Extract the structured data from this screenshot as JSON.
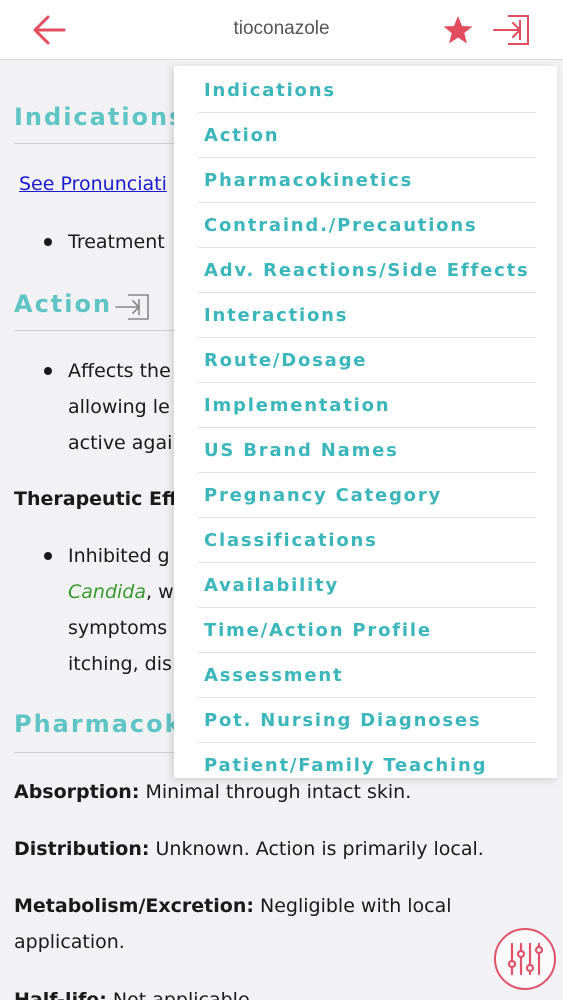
{
  "header": {
    "title": "tioconazole"
  },
  "colors": {
    "accent_red": "#e24c5e",
    "heading_teal": "#5fc4c4",
    "menu_teal": "#3bb6bb",
    "link_blue": "#1a1acc",
    "italic_green": "#3a9a2e"
  },
  "icons": {
    "back": "arrow-left-icon",
    "favorite": "star-icon",
    "exit": "exit-arrow-icon",
    "section_jump": "exit-arrow-icon",
    "filter": "sliders-icon"
  },
  "content": {
    "indications_heading": "Indications",
    "pronunciation_link": "See Pronunciati",
    "indication_bullet": "Treatment",
    "action_heading": "Action",
    "action_line1": "Affects the",
    "action_line2": "allowing le",
    "action_line3": "active agai",
    "therapeutic_heading": "Therapeutic Eff",
    "therapeutic_line1": "Inhibited g",
    "therapeutic_line2_italic": "Candida",
    "therapeutic_line2_rest": ", w",
    "therapeutic_line3": "symptoms",
    "therapeutic_line4": "itching, dis",
    "pharmacokinetics_heading": "Pharmacok",
    "absorption_label": "Absorption:",
    "absorption_value": " Minimal through intact skin.",
    "distribution_label": "Distribution:",
    "distribution_value": " Unknown. Action is primarily local.",
    "metabolism_label": "Metabolism/Excretion:",
    "metabolism_value": " Negligible with local",
    "metabolism_value2": "application.",
    "halflife_label": "Half-life:",
    "halflife_value": " Not applicable"
  },
  "menu": {
    "items": [
      "Indications",
      "Action",
      "Pharmacokinetics",
      "Contraind./Precautions",
      "Adv. Reactions/Side Effects",
      "Interactions",
      "Route/Dosage",
      "Implementation",
      "US Brand Names",
      "Pregnancy Category",
      "Classifications",
      "Availability",
      "Time/Action Profile",
      "Assessment",
      "Pot. Nursing Diagnoses",
      "Patient/Family Teaching"
    ]
  }
}
